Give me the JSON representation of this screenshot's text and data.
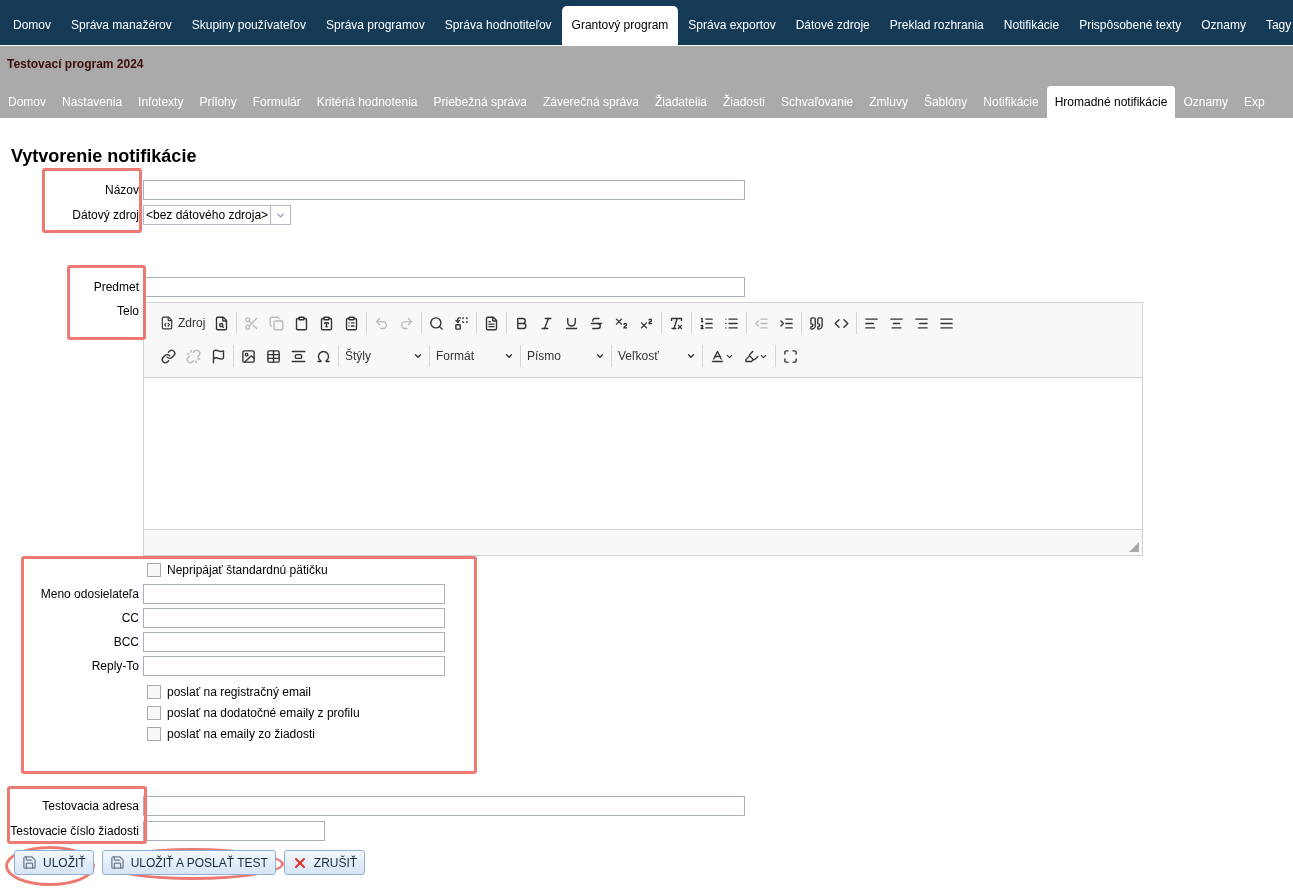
{
  "top_nav": [
    {
      "label": "Domov",
      "selected": false
    },
    {
      "label": "Správa manažérov",
      "selected": false
    },
    {
      "label": "Skupiny používateľov",
      "selected": false
    },
    {
      "label": "Správa programov",
      "selected": false
    },
    {
      "label": "Správa hodnotiteľov",
      "selected": false
    },
    {
      "label": "Grantový program",
      "selected": true
    },
    {
      "label": "Správa exportov",
      "selected": false
    },
    {
      "label": "Dátové zdroje",
      "selected": false
    },
    {
      "label": "Preklad rozhrania",
      "selected": false
    },
    {
      "label": "Notifikácie",
      "selected": false
    },
    {
      "label": "Prispôsobené texty",
      "selected": false
    },
    {
      "label": "Oznamy",
      "selected": false
    },
    {
      "label": "Tagy",
      "selected": false
    }
  ],
  "program_title": "Testovací program 2024",
  "sub_nav": [
    {
      "label": "Domov",
      "selected": false
    },
    {
      "label": "Nastavenia",
      "selected": false
    },
    {
      "label": "Infotexty",
      "selected": false
    },
    {
      "label": "Prílohy",
      "selected": false
    },
    {
      "label": "Formulár",
      "selected": false
    },
    {
      "label": "Kritériá hodnotenia",
      "selected": false
    },
    {
      "label": "Priebežná správa",
      "selected": false
    },
    {
      "label": "Záverečná správa",
      "selected": false
    },
    {
      "label": "Žiadatelia",
      "selected": false
    },
    {
      "label": "Žiadosti",
      "selected": false
    },
    {
      "label": "Schvaľovanie",
      "selected": false
    },
    {
      "label": "Zmluvy",
      "selected": false
    },
    {
      "label": "Šablóny",
      "selected": false
    },
    {
      "label": "Notifikácie",
      "selected": false
    },
    {
      "label": "Hromadné notifikácie",
      "selected": true
    },
    {
      "label": "Oznamy",
      "selected": false
    },
    {
      "label": "Exp",
      "selected": false
    }
  ],
  "heading": "Vytvorenie notifikácie",
  "name_field": {
    "label": "Názov"
  },
  "data_source": {
    "label": "Dátový zdroj",
    "value": "<bez dátového zdroja>"
  },
  "subject_field": {
    "label": "Predmet"
  },
  "body": {
    "label": "Telo",
    "toolbar": [
      [
        [
          {
            "kind": "source",
            "label": "Zdroj",
            "disabled": false
          },
          {
            "kind": "preview",
            "disabled": false
          }
        ],
        [
          {
            "kind": "cut",
            "disabled": true
          },
          {
            "kind": "copy",
            "disabled": true
          },
          {
            "kind": "paste",
            "disabled": false
          },
          {
            "kind": "paste-text",
            "disabled": false
          },
          {
            "kind": "paste-word",
            "disabled": false
          }
        ],
        [
          {
            "kind": "undo",
            "disabled": true
          },
          {
            "kind": "redo",
            "disabled": true
          }
        ],
        [
          {
            "kind": "find",
            "disabled": false
          },
          {
            "kind": "replace",
            "disabled": false
          }
        ],
        [
          {
            "kind": "select-all",
            "disabled": false
          }
        ],
        [
          {
            "kind": "bold",
            "disabled": false
          },
          {
            "kind": "italic",
            "disabled": false
          },
          {
            "kind": "underline",
            "disabled": false
          },
          {
            "kind": "strike",
            "disabled": false
          },
          {
            "kind": "subscript",
            "disabled": false
          },
          {
            "kind": "superscript",
            "disabled": false
          }
        ],
        [
          {
            "kind": "clear-format",
            "disabled": false
          }
        ],
        [
          {
            "kind": "numbered-list",
            "disabled": false
          },
          {
            "kind": "bullet-list",
            "disabled": false
          }
        ],
        [
          {
            "kind": "outdent",
            "disabled": true
          },
          {
            "kind": "indent",
            "disabled": false
          }
        ],
        [
          {
            "kind": "quote",
            "disabled": false
          },
          {
            "kind": "div",
            "disabled": false
          }
        ],
        [
          {
            "kind": "align-left",
            "disabled": false
          },
          {
            "kind": "align-center",
            "disabled": false
          },
          {
            "kind": "align-right",
            "disabled": false
          },
          {
            "kind": "justify",
            "disabled": false
          }
        ]
      ],
      [
        [
          {
            "kind": "link",
            "disabled": false
          },
          {
            "kind": "unlink",
            "disabled": true
          },
          {
            "kind": "anchor",
            "disabled": false
          }
        ],
        [
          {
            "kind": "image",
            "disabled": false
          },
          {
            "kind": "table",
            "disabled": false
          },
          {
            "kind": "hr",
            "disabled": false
          },
          {
            "kind": "symbol",
            "disabled": false
          }
        ],
        [
          {
            "kind": "dropdown",
            "label": "Štýly",
            "disabled": false
          }
        ],
        [
          {
            "kind": "dropdown",
            "label": "Formát",
            "disabled": false
          }
        ],
        [
          {
            "kind": "dropdown",
            "label": "Písmo",
            "disabled": false
          }
        ],
        [
          {
            "kind": "dropdown",
            "label": "Veľkosť",
            "disabled": false
          }
        ],
        [
          {
            "kind": "text-color",
            "disabled": false
          },
          {
            "kind": "bg-color",
            "disabled": false
          }
        ],
        [
          {
            "kind": "maximize",
            "disabled": false
          }
        ]
      ]
    ]
  },
  "no_footer": {
    "label": "Nepripájať štandardnú pätičku",
    "checked": false
  },
  "sender_fields": [
    {
      "label": "Meno odosielateľa"
    },
    {
      "label": "CC"
    },
    {
      "label": "BCC"
    },
    {
      "label": "Reply-To"
    }
  ],
  "send_options": [
    {
      "label": "poslať na registračný email",
      "checked": false
    },
    {
      "label": "poslať na dodatočné emaily z profilu",
      "checked": false
    },
    {
      "label": "poslať na emaily zo žiadosti",
      "checked": false
    }
  ],
  "test_address": {
    "label": "Testovacia adresa"
  },
  "test_application": {
    "label": "Testovacie číslo žiadosti"
  },
  "buttons": [
    {
      "kind": "save",
      "label": "ULOŽIŤ"
    },
    {
      "kind": "save",
      "label": "ULOŽIŤ A POSLAŤ TEST"
    },
    {
      "kind": "cancel",
      "label": "ZRUŠIŤ"
    }
  ]
}
